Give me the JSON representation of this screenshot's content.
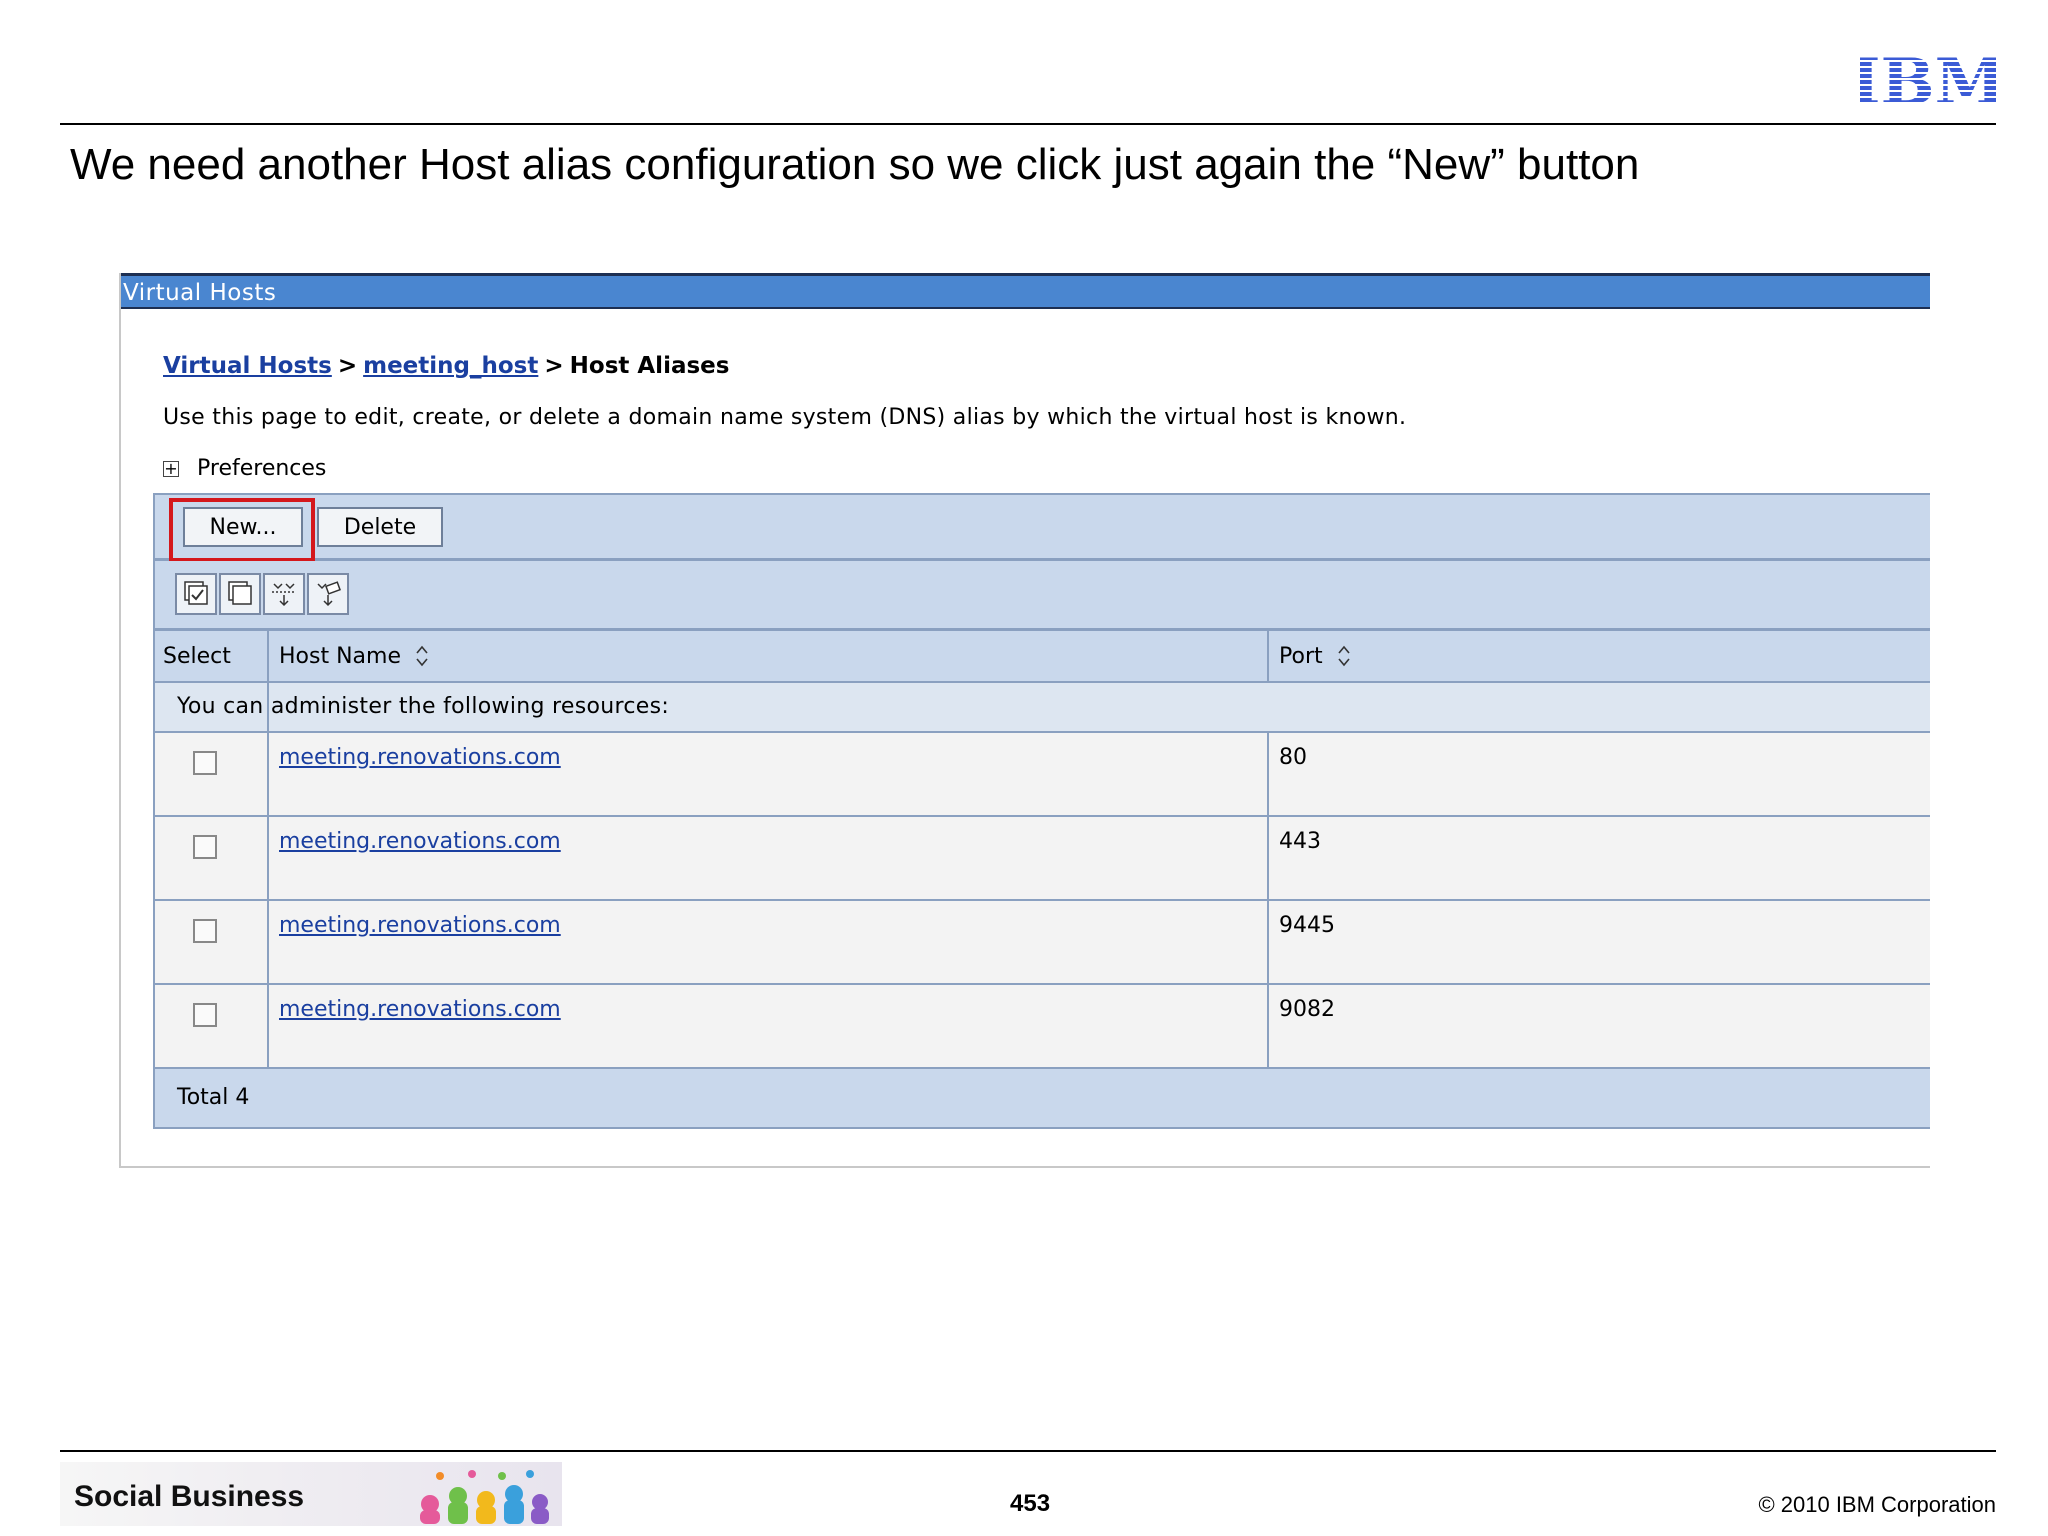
{
  "slide": {
    "title": "We need another Host alias configuration so we click just again the “New” button",
    "page_number": "453",
    "copyright": "© 2010 IBM Corporation",
    "footer_brand": "Social Business",
    "logo_text": "IBM"
  },
  "panel": {
    "header": "Virtual Hosts",
    "breadcrumb": {
      "link1": "Virtual Hosts",
      "link2": "meeting_host",
      "current": "Host Aliases",
      "separator": ">"
    },
    "description": "Use this page to edit, create, or delete a domain name system (DNS) alias by which the virtual host is known.",
    "preferences": "Preferences",
    "buttons": {
      "new": "New...",
      "delete": "Delete"
    },
    "toolbar_icons": [
      "select-all-icon",
      "deselect-all-icon",
      "show-filter-icon",
      "clear-filter-icon"
    ],
    "table": {
      "columns": {
        "select": "Select",
        "host_name": "Host Name",
        "port": "Port"
      },
      "info": "You can administer the following resources:",
      "rows": [
        {
          "host": "meeting.renovations.com",
          "port": "80"
        },
        {
          "host": "meeting.renovations.com",
          "port": "443"
        },
        {
          "host": "meeting.renovations.com",
          "port": "9445"
        },
        {
          "host": "meeting.renovations.com",
          "port": "9082"
        }
      ],
      "total": "Total 4"
    }
  },
  "colors": {
    "header_blue": "#4a86d0",
    "table_blue": "#c9d8ec",
    "link_blue": "#1a3fa0",
    "highlight_red": "#d4171c",
    "ibm_logo_blue": "#3b5bd6"
  }
}
